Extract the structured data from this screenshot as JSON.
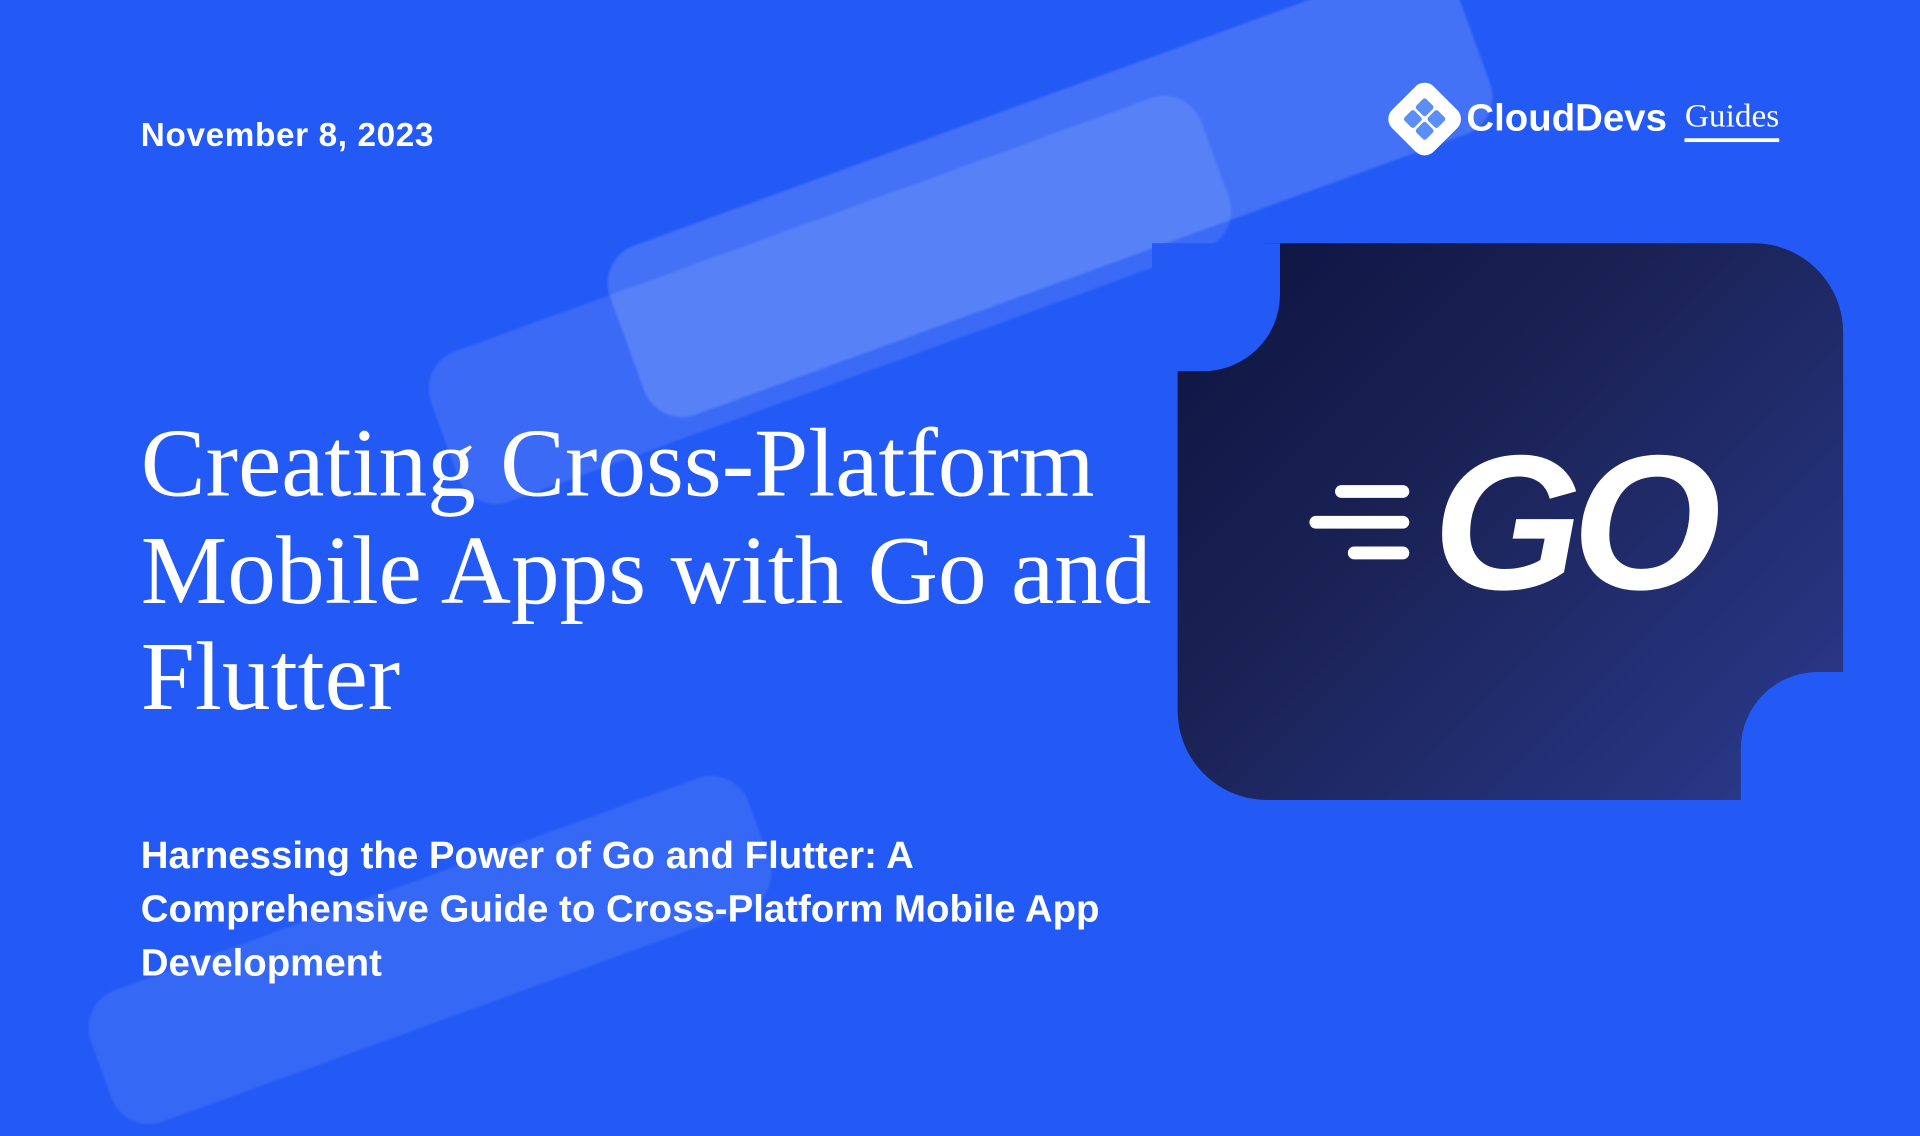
{
  "date": "November 8, 2023",
  "brand": {
    "name": "CloudDevs",
    "sub": "Guides"
  },
  "title": "Creating Cross-Platform Mobile Apps with Go and Flutter",
  "logo_text": "GO",
  "subtitle": "Harnessing the Power of Go and Flutter: A Comprehensive Guide to Cross-Platform Mobile App Development"
}
